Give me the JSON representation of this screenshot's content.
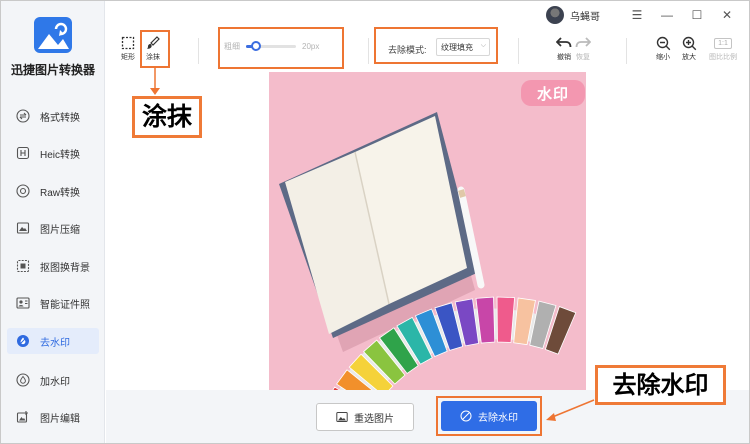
{
  "app": {
    "title": "迅捷图片转换器"
  },
  "user": {
    "name": "乌蝇哥"
  },
  "window_controls": {
    "menu": "☰",
    "minimize": "—",
    "maximize": "☐",
    "close": "✕"
  },
  "sidebar": {
    "items": [
      {
        "label": "格式转换",
        "icon": "convert-icon"
      },
      {
        "label": "Heic转换",
        "icon": "heic-icon"
      },
      {
        "label": "Raw转换",
        "icon": "raw-icon"
      },
      {
        "label": "图片压缩",
        "icon": "compress-icon"
      },
      {
        "label": "抠图换背景",
        "icon": "cutout-icon"
      },
      {
        "label": "智能证件照",
        "icon": "id-photo-icon"
      },
      {
        "label": "去水印",
        "icon": "remove-watermark-icon",
        "active": true
      },
      {
        "label": "加水印",
        "icon": "add-watermark-icon"
      },
      {
        "label": "图片编辑",
        "icon": "edit-icon"
      }
    ]
  },
  "toolbar": {
    "rect_label": "矩形",
    "smear_label": "涂抹",
    "brush_label": "粗细",
    "brush_value": "20px",
    "brush_level": 0.2,
    "mode_label": "去除模式:",
    "mode_value": "纹理填充",
    "undo_label": "撤销",
    "redo_label": "恢复",
    "zoom_out_label": "缩小",
    "zoom_in_label": "放大",
    "ratio_value": "1:1",
    "original_label": "图比比例"
  },
  "canvas": {
    "watermark_text": "水印"
  },
  "bottom": {
    "reselect_label": "重选图片",
    "remove_label": "去除水印"
  },
  "annotations": {
    "smear_callout": "涂抹",
    "remove_callout": "去除水印"
  },
  "colors": {
    "accent": "#2f6de6",
    "annotation": "#ef7a37",
    "photo_bg": "#f4bccb"
  }
}
